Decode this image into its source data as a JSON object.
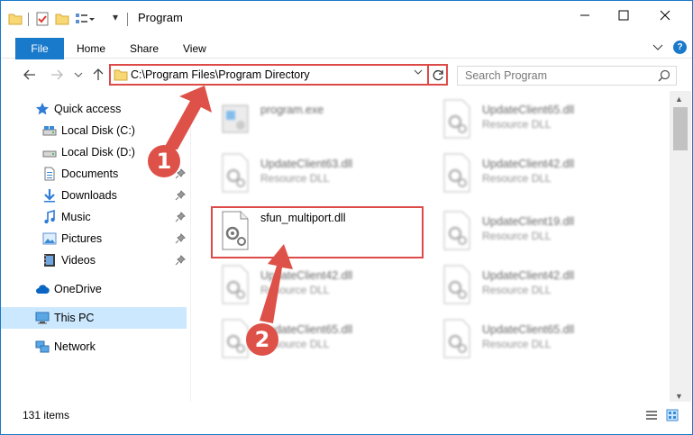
{
  "window": {
    "title": "Program"
  },
  "ribbon": {
    "file": "File",
    "tabs": [
      "Home",
      "Share",
      "View"
    ],
    "help": "?"
  },
  "nav": {
    "address": "C:\\Program Files\\Program Directory",
    "search_placeholder": "Search Program"
  },
  "sidebar": {
    "items": [
      {
        "label": "Quick access",
        "icon": "star-icon"
      },
      {
        "label": "Local Disk (C:)",
        "icon": "drive-icon"
      },
      {
        "label": "Local Disk (D:)",
        "icon": "drive-icon"
      },
      {
        "label": "Documents",
        "icon": "documents-icon",
        "pinned": true
      },
      {
        "label": "Downloads",
        "icon": "download-icon",
        "pinned": true
      },
      {
        "label": "Music",
        "icon": "music-icon",
        "pinned": true
      },
      {
        "label": "Pictures",
        "icon": "pictures-icon",
        "pinned": true
      },
      {
        "label": "Videos",
        "icon": "videos-icon",
        "pinned": true
      },
      {
        "label": "OneDrive",
        "icon": "cloud-icon"
      },
      {
        "label": "This PC",
        "icon": "computer-icon",
        "selected": true
      },
      {
        "label": "Network",
        "icon": "network-icon"
      }
    ]
  },
  "files": [
    {
      "name": "program.exe",
      "type": ""
    },
    {
      "name": "UpdateClient65.dll",
      "type": "Resource DLL"
    },
    {
      "name": "UpdateClient63.dll",
      "type": "Resource DLL"
    },
    {
      "name": "UpdateClient42.dll",
      "type": "Resource DLL"
    },
    {
      "name": "sfun_multiport.dll",
      "type": ""
    },
    {
      "name": "UpdateClient19.dll",
      "type": "Resource DLL"
    },
    {
      "name": "UpdateClient42.dll",
      "type": "Resource DLL"
    },
    {
      "name": "UpdateClient42.dll",
      "type": "Resource DLL"
    },
    {
      "name": "UpdateClient65.dll",
      "type": "Resource DLL"
    },
    {
      "name": "UpdateClient65.dll",
      "type": "Resource DLL"
    }
  ],
  "callouts": {
    "one": "1",
    "two": "2"
  },
  "status": {
    "count": "131 items"
  },
  "colors": {
    "accent": "#1979ca",
    "highlight": "#dc4b48",
    "callout": "#de5149",
    "selected": "#cce8ff"
  }
}
